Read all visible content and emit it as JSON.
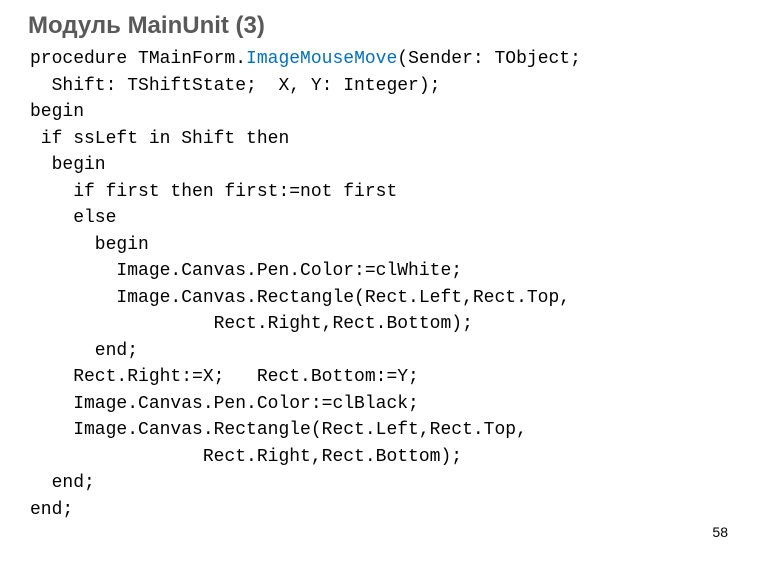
{
  "title": "Модуль MainUnit (3)",
  "code": {
    "l1a": "procedure TMainForm.",
    "l1b": "ImageMouseMove",
    "l1c": "(Sender: TObject;",
    "l2": "  Shift: TShiftState;  X, Y: Integer);",
    "l3": "begin",
    "l4": " if ssLeft in Shift then",
    "l5": "  begin",
    "l6": "    if first then first:=not first",
    "l7": "    else",
    "l8": "      begin",
    "l9": "        Image.Canvas.Pen.Color:=clWhite;",
    "l10": "        Image.Canvas.Rectangle(Rect.Left,Rect.Top,",
    "l11": "                 Rect.Right,Rect.Bottom);",
    "l12": "      end;",
    "l13": "    Rect.Right:=X;   Rect.Bottom:=Y;",
    "l14": "    Image.Canvas.Pen.Color:=clBlack;",
    "l15": "    Image.Canvas.Rectangle(Rect.Left,Rect.Top,",
    "l16": "                Rect.Right,Rect.Bottom);",
    "l17": "  end;",
    "l18": "end;"
  },
  "page_number": "58"
}
